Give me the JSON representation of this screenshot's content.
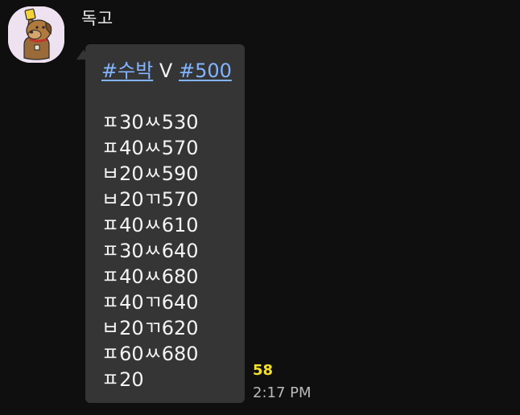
{
  "message": {
    "sender": "독고",
    "hashtags": [
      "#수박",
      "#500"
    ],
    "separator": " V ",
    "lines": [
      "ㅍ30ㅆ530",
      "ㅍ40ㅆ570",
      "ㅂ20ㅆ590",
      "ㅂ20ㄲ570",
      "ㅍ40ㅆ610",
      "ㅍ30ㅆ640",
      "ㅍ40ㅆ680",
      "ㅍ40ㄲ640",
      "ㅂ20ㄲ620",
      "ㅍ60ㅆ680",
      "ㅍ20"
    ],
    "unread_count": "58",
    "time": "2:17 PM"
  },
  "avatar": {
    "icon": "dog-character-holding-yellow-card-icon"
  },
  "colors": {
    "background": "#0f0f0f",
    "bubble": "#353535",
    "hashtag": "#82b4ff",
    "unread": "#f5e02c",
    "timestamp": "#b9b9b9"
  }
}
